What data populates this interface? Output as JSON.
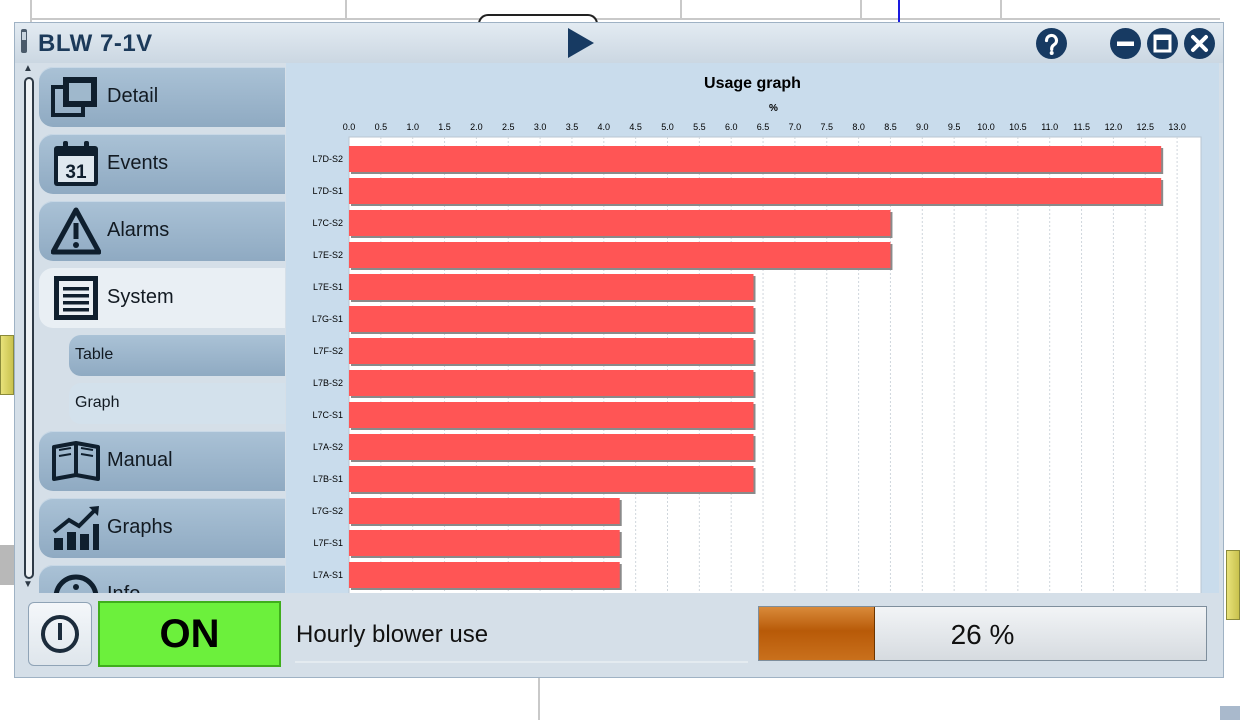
{
  "window": {
    "title": "BLW 7-1V"
  },
  "sidebar": {
    "items": [
      {
        "label": "Detail",
        "icon": "detail-icon"
      },
      {
        "label": "Events",
        "icon": "calendar-icon",
        "icon_text": "31"
      },
      {
        "label": "Alarms",
        "icon": "warning-icon"
      },
      {
        "label": "System",
        "icon": "list-icon",
        "active": true
      },
      {
        "label": "Manual",
        "icon": "book-icon"
      },
      {
        "label": "Graphs",
        "icon": "trend-chart-icon"
      },
      {
        "label": "Info",
        "icon": "info-icon"
      }
    ],
    "subitems": [
      {
        "label": "Table"
      },
      {
        "label": "Graph",
        "active": true
      }
    ]
  },
  "footer": {
    "status": "ON",
    "label": "Hourly blower use",
    "progress_percent": 26,
    "progress_text": "26 %"
  },
  "colors": {
    "bar": "#ff5555",
    "status_on": "#6cf03c",
    "progress": "#c9701c",
    "title_button": "#173a62"
  },
  "chart_data": {
    "type": "bar",
    "orientation": "horizontal",
    "title": "Usage graph",
    "xlabel": "%",
    "ylabel": "",
    "xlim": [
      0,
      13.0
    ],
    "x_ticks": [
      "0.0",
      "0.5",
      "1.0",
      "1.5",
      "2.0",
      "2.5",
      "3.0",
      "3.5",
      "4.0",
      "4.5",
      "5.0",
      "5.5",
      "6.0",
      "6.5",
      "7.0",
      "7.5",
      "8.0",
      "8.5",
      "9.0",
      "9.5",
      "10.0",
      "10.5",
      "11.0",
      "11.5",
      "12.0",
      "12.5",
      "13.0"
    ],
    "grid": true,
    "categories": [
      "L7D-S2",
      "L7D-S1",
      "L7C-S2",
      "L7E-S2",
      "L7E-S1",
      "L7G-S1",
      "L7F-S2",
      "L7B-S2",
      "L7C-S1",
      "L7A-S2",
      "L7B-S1",
      "L7G-S2",
      "L7F-S1",
      "L7A-S1"
    ],
    "values": [
      12.75,
      12.75,
      8.5,
      8.5,
      6.35,
      6.35,
      6.35,
      6.35,
      6.35,
      6.35,
      6.35,
      4.25,
      4.25,
      4.25
    ]
  }
}
